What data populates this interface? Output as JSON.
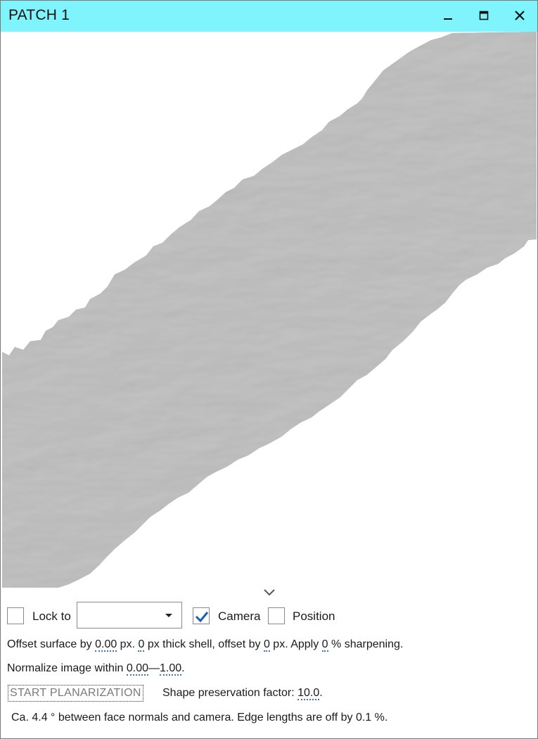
{
  "window": {
    "title": "PATCH 1",
    "title_bar_color": "#80f4fc",
    "controls": [
      "minimize-icon",
      "maximize-icon",
      "close-icon"
    ]
  },
  "viewport": {
    "content": "gray shaded surface patch",
    "surface_color": "#8f8f8f"
  },
  "controls": {
    "lock_to": {
      "label": "Lock to",
      "checked": false,
      "selected_value": ""
    },
    "camera": {
      "label": "Camera",
      "checked": true
    },
    "position": {
      "label": "Position",
      "checked": false
    }
  },
  "offset_line": {
    "t1": "Offset surface by ",
    "offset_value": "0.00",
    "t2": " px. ",
    "shell_value": "0",
    "t3": " px thick shell, offset by ",
    "shell_offset_value": "0",
    "t4": " px. Apply ",
    "sharpen_value": "0",
    "t5": " % sharpening."
  },
  "normalize_line": {
    "t1": "Normalize image within ",
    "min_value": "0.00",
    "dash": "—",
    "max_value": "1.00",
    "t2": "."
  },
  "planarization": {
    "button_label": "START PLANARIZATION",
    "factor_label": "Shape preservation factor: ",
    "factor_value": "10.0",
    "factor_end": "."
  },
  "status": {
    "text": "Ca. 4.4 ° between face normals and camera. Edge lengths are off by 0.1 %."
  }
}
